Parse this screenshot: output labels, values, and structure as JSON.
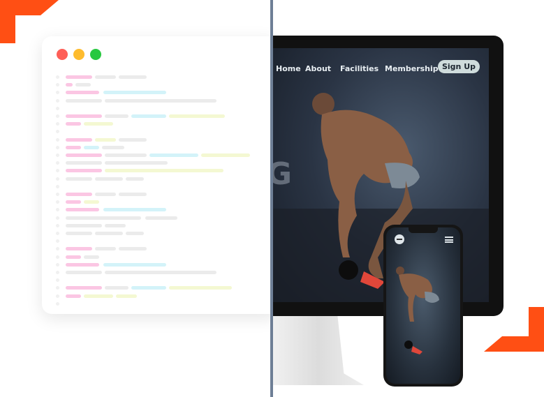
{
  "editor": {
    "window_controls": [
      {
        "name": "close",
        "color": "#fe5f57"
      },
      {
        "name": "minimize",
        "color": "#febc2e"
      },
      {
        "name": "maximize",
        "color": "#28c840"
      }
    ]
  },
  "website": {
    "nav": [
      "Home",
      "About",
      "Facilities",
      "Membership"
    ],
    "signup_label": "Sign Up",
    "hero_text_fragment": "NG"
  },
  "phone": {
    "logo_icon": "dumbbell-icon",
    "menu_icon": "hamburger-menu-icon"
  },
  "colors": {
    "accent": "#ff5a1f",
    "divider": "#6e7f96",
    "code_pink": "#fbc6e3",
    "code_gray": "#ebebeb",
    "code_cyan": "#d3f3f9",
    "code_yellow": "#f4f8d2"
  }
}
